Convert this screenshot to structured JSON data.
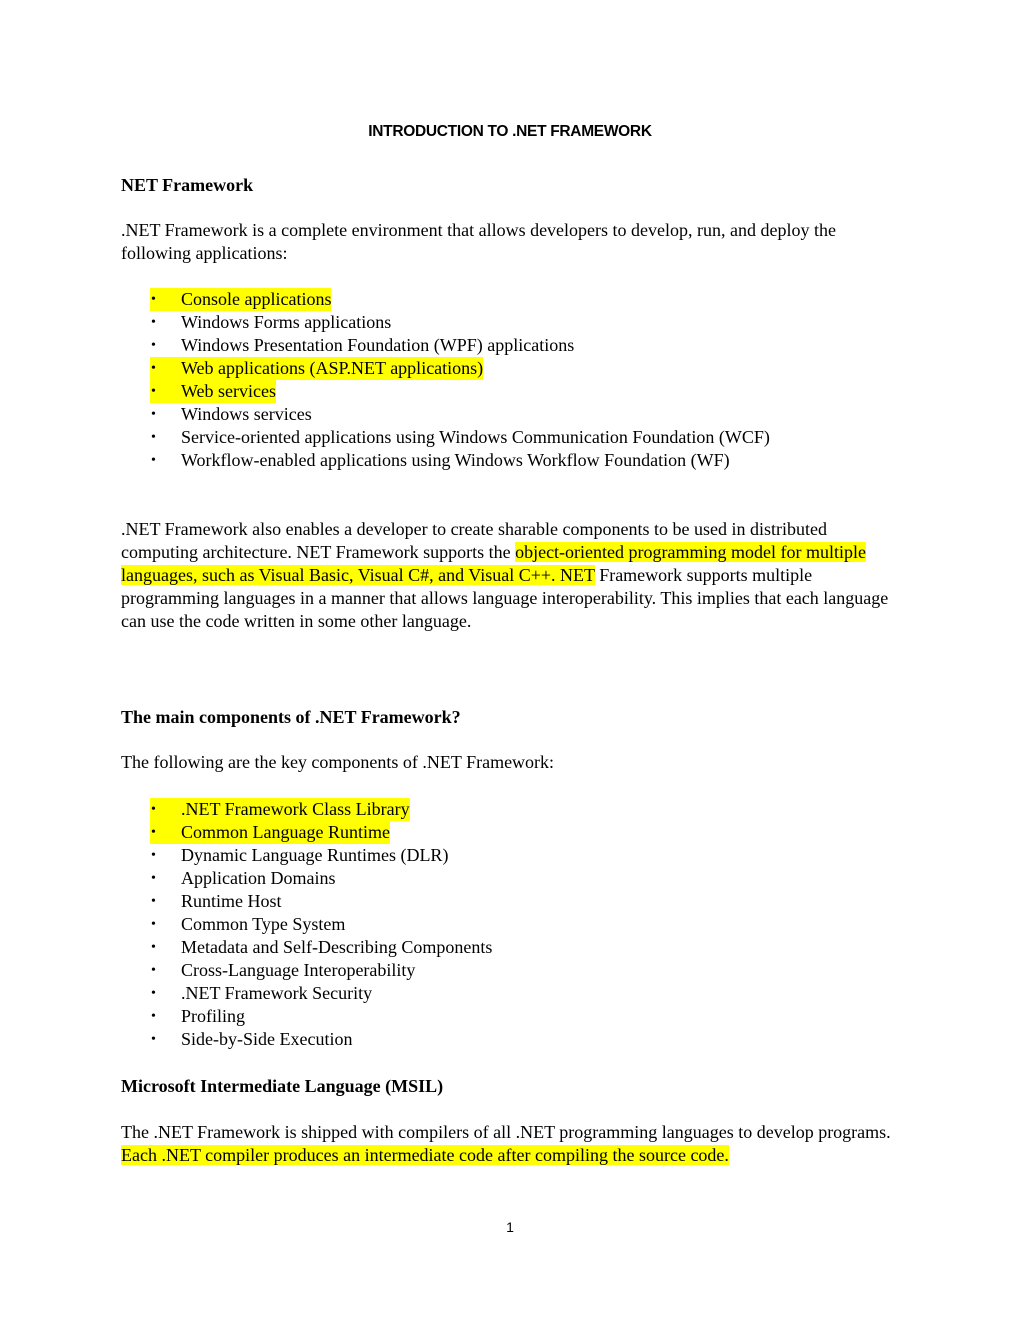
{
  "document": {
    "title": "INTRODUCTION TO .NET FRAMEWORK",
    "highlight_color": "#ffff00",
    "page_number": "1"
  },
  "section1": {
    "heading": "NET Framework",
    "intro": ".NET Framework is a complete environment that allows developers to develop, run, and deploy the following applications:",
    "applications": [
      {
        "text": "Console applications",
        "highlighted": true
      },
      {
        "text": "Windows Forms applications",
        "highlighted": false
      },
      {
        "text": "Windows Presentation Foundation (WPF) applications",
        "highlighted": false
      },
      {
        "text": "Web applications (ASP.NET applications)",
        "highlighted": true
      },
      {
        "text": "Web services",
        "highlighted": true
      },
      {
        "text": "Windows services",
        "highlighted": false
      },
      {
        "text": "Service-oriented applications using Windows Communication Foundation (WCF)",
        "highlighted": false
      },
      {
        "text": "Workflow-enabled applications using Windows Workflow Foundation (WF)",
        "highlighted": false
      }
    ],
    "paragraph2": {
      "before": ".NET Framework also enables a developer to create sharable components to be used in distributed computing architecture. NET Framework supports the ",
      "highlighted": "object-oriented programming model for multiple languages, such as Visual Basic, Visual C#, and Visual C++. NET",
      "after": " Framework supports multiple programming languages in a manner that allows language interoperability. This implies that each language can use the code written in some other language."
    }
  },
  "section2": {
    "heading": "The main components of .NET Framework?",
    "intro": "The following are the key components of .NET Framework:",
    "components": [
      {
        "text": ".NET Framework Class Library",
        "highlighted": true
      },
      {
        "text": "Common Language Runtime",
        "highlighted": true
      },
      {
        "text": "Dynamic Language Runtimes (DLR)",
        "highlighted": false
      },
      {
        "text": "Application Domains",
        "highlighted": false
      },
      {
        "text": "Runtime Host",
        "highlighted": false
      },
      {
        "text": "Common Type System",
        "highlighted": false
      },
      {
        "text": "Metadata and Self-Describing Components",
        "highlighted": false
      },
      {
        "text": "Cross-Language Interoperability",
        "highlighted": false
      },
      {
        "text": ".NET Framework Security",
        "highlighted": false
      },
      {
        "text": "Profiling",
        "highlighted": false
      },
      {
        "text": "Side-by-Side Execution",
        "highlighted": false
      }
    ]
  },
  "section3": {
    "heading": "Microsoft Intermediate Language (MSIL)",
    "paragraph": {
      "before": "The .NET Framework is shipped with compilers of all .NET programming languages to develop programs. ",
      "highlighted": "Each .NET compiler produces an intermediate code after compiling the source code."
    }
  },
  "icons": {
    "bullet": "•"
  }
}
